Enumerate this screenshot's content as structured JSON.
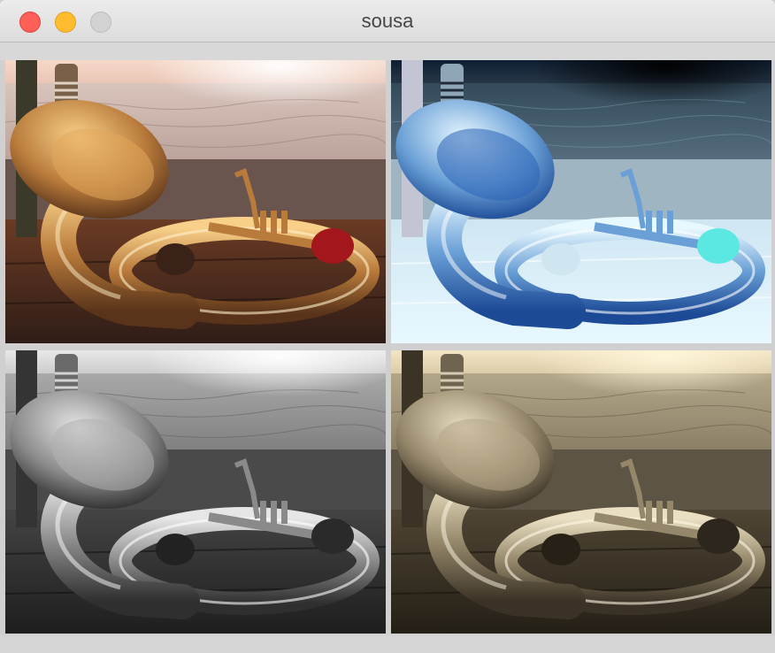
{
  "window": {
    "title": "sousa"
  },
  "controls": {
    "close": "close-window",
    "minimize": "minimize-window",
    "zoom": "zoom-window"
  },
  "images": [
    {
      "variant": "original-color"
    },
    {
      "variant": "inverted"
    },
    {
      "variant": "grayscale"
    },
    {
      "variant": "sepia"
    }
  ]
}
